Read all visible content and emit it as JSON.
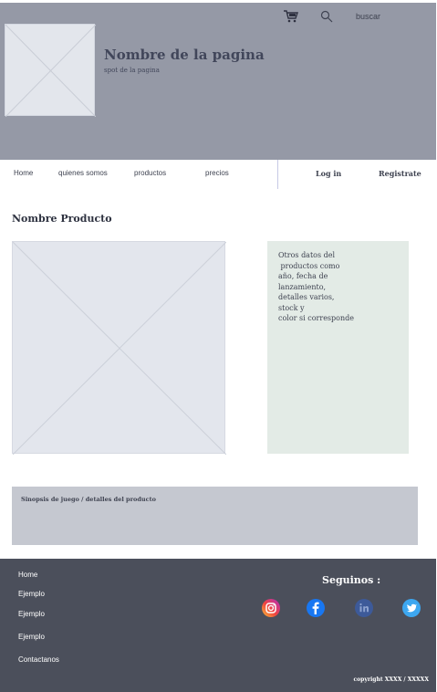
{
  "header": {
    "site_title": "Nombre de la pagina",
    "site_subtitle": "spot de la pagina",
    "cart_icon": "shopping-cart-icon",
    "search_icon": "search-icon",
    "search_placeholder": "buscar"
  },
  "nav": {
    "links": [
      {
        "label": "Home"
      },
      {
        "label": "quienes somos"
      },
      {
        "label": "productos"
      },
      {
        "label": "precios"
      }
    ],
    "login_label": "Log in",
    "register_label": "Registrate"
  },
  "product": {
    "name": "Nombre Producto",
    "details_lines": [
      "Otros datos del",
      " productos como",
      "año, fecha de",
      "lanzamiento,",
      "detalles varios,",
      "stock y",
      "color si corresponde"
    ],
    "synopsis": "Sinopsis de juego / detalles del producto"
  },
  "footer": {
    "links": [
      {
        "label": "Home"
      },
      {
        "label": "Ejemplo"
      },
      {
        "label": "Ejemplo"
      },
      {
        "label": "Ejemplo"
      },
      {
        "label": "Contactanos"
      }
    ],
    "follow_label": "Seguinos :",
    "social_icons": [
      "instagram-icon",
      "facebook-icon",
      "linkedin-icon",
      "twitter-icon"
    ],
    "copyright": "copyright XXXX / XXXXX"
  },
  "colors": {
    "header_bg": "#9599a6",
    "footer_bg": "#4b4f5b",
    "details_bg": "#e3ebe6",
    "synopsis_bg": "#c5c8d0"
  }
}
